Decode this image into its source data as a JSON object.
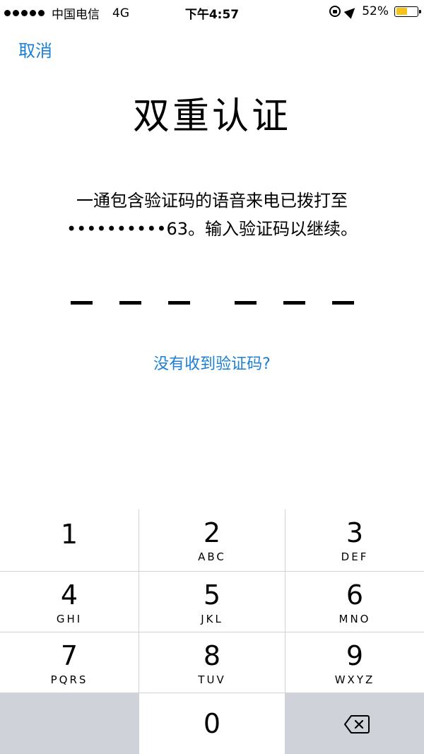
{
  "status_bar": {
    "carrier": "中国电信",
    "network": "4G",
    "time": "下午4:57",
    "battery_percent": "52%",
    "battery_level": 0.52,
    "battery_color": "#f7c31b"
  },
  "nav": {
    "cancel_label": "取消"
  },
  "title": "双重认证",
  "instructions": {
    "line1": "一通包含验证码的语音来电已拨打至",
    "line2": "••••••••••63。输入验证码以继续。"
  },
  "code_entry": {
    "digits": [
      "",
      "",
      "",
      "",
      "",
      ""
    ]
  },
  "resend_link": "没有收到验证码?",
  "keypad": {
    "keys": [
      {
        "digit": "1",
        "letters": ""
      },
      {
        "digit": "2",
        "letters": "ABC"
      },
      {
        "digit": "3",
        "letters": "DEF"
      },
      {
        "digit": "4",
        "letters": "GHI"
      },
      {
        "digit": "5",
        "letters": "JKL"
      },
      {
        "digit": "6",
        "letters": "MNO"
      },
      {
        "digit": "7",
        "letters": "PQRS"
      },
      {
        "digit": "8",
        "letters": "TUV"
      },
      {
        "digit": "9",
        "letters": "WXYZ"
      },
      {
        "digit": "0",
        "letters": ""
      }
    ],
    "delete_icon": "backspace-icon"
  },
  "colors": {
    "accent": "#1c7fd6",
    "keypad_bg": "#cfd3d9"
  }
}
